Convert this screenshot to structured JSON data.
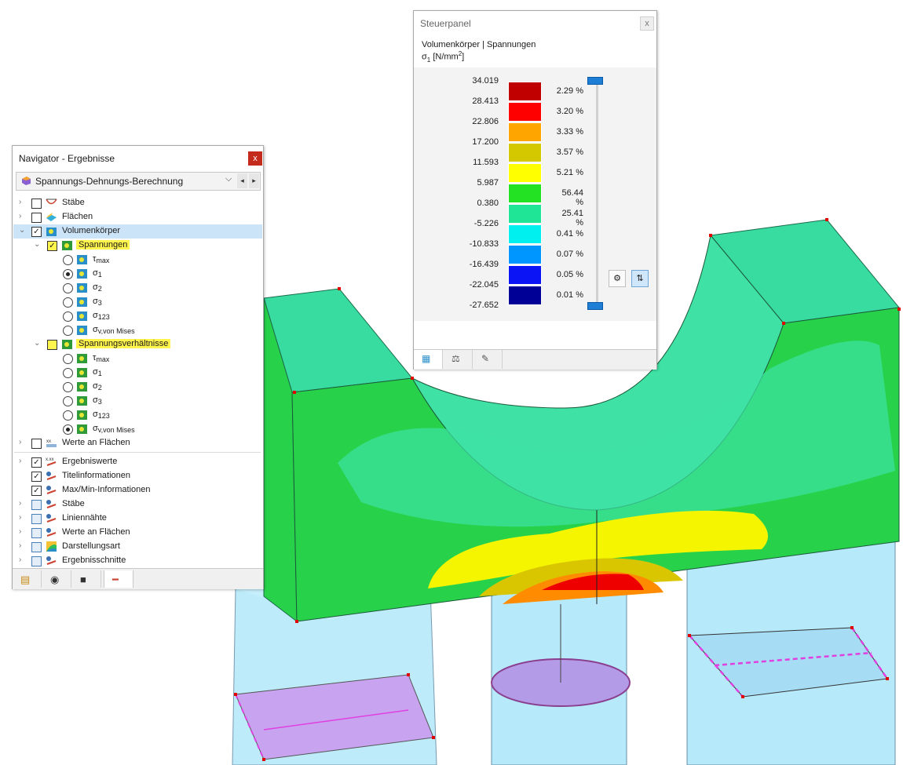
{
  "navigator": {
    "title": "Navigator - Ergebnisse",
    "close": "x",
    "combo": {
      "label": "Spannungs-Dehnungs-Berechnung",
      "arrow": "⌵",
      "prev": "◂",
      "next": "▸"
    },
    "items": [
      {
        "label": "Stäbe"
      },
      {
        "label": "Flächen"
      },
      {
        "label": "Volumenkörper"
      },
      {
        "label": "Spannungen"
      },
      {
        "label": "τ",
        "sub": "max"
      },
      {
        "label": "σ",
        "sub": "1"
      },
      {
        "label": "σ",
        "sub": "2"
      },
      {
        "label": "σ",
        "sub": "3"
      },
      {
        "label": "σ",
        "sub": "123"
      },
      {
        "label": "σ",
        "sub": "v,von Mises"
      },
      {
        "label": "Spannungsverhältnisse"
      },
      {
        "label": "τ",
        "sub": "max"
      },
      {
        "label": "σ",
        "sub": "1"
      },
      {
        "label": "σ",
        "sub": "2"
      },
      {
        "label": "σ",
        "sub": "3"
      },
      {
        "label": "σ",
        "sub": "123"
      },
      {
        "label": "σ",
        "sub": "v,von Mises"
      },
      {
        "label": "Werte an Flächen"
      },
      {
        "label": "Ergebniswerte"
      },
      {
        "label": "Titelinformationen"
      },
      {
        "label": "Max/Min-Informationen"
      },
      {
        "label": "Stäbe"
      },
      {
        "label": "Liniennähte"
      },
      {
        "label": "Werte an Flächen"
      },
      {
        "label": "Darstellungsart"
      },
      {
        "label": "Ergebnisschnitte"
      }
    ],
    "tabs": [
      "data-icon",
      "eye-icon",
      "camera-icon",
      "display-icon"
    ]
  },
  "control_panel": {
    "title": "Steuerpanel",
    "close": "x",
    "header": "Volumenkörper | Spannungen",
    "quantity": "σ",
    "quantity_sub": "1",
    "unit": "[N/mm",
    "unit_sup": "2",
    "unit_end": "]",
    "scale_values": [
      "34.019",
      "28.413",
      "22.806",
      "17.200",
      "11.593",
      "5.987",
      "0.380",
      "-5.226",
      "-10.833",
      "-16.439",
      "-22.045",
      "-27.652"
    ],
    "bands": [
      {
        "color": "#c00000",
        "percent": "2.29 %"
      },
      {
        "color": "#ff0000",
        "percent": "3.20 %"
      },
      {
        "color": "#ffa500",
        "percent": "3.33 %"
      },
      {
        "color": "#d4c800",
        "percent": "3.57 %"
      },
      {
        "color": "#ffff00",
        "percent": "5.21 %"
      },
      {
        "color": "#23e123",
        "percent": "56.44 %"
      },
      {
        "color": "#1ee696",
        "percent": "25.41 %"
      },
      {
        "color": "#00f0f0",
        "percent": "0.41 %"
      },
      {
        "color": "#0096ff",
        "percent": "0.07 %"
      },
      {
        "color": "#0a14f5",
        "percent": "0.05 %"
      },
      {
        "color": "#000096",
        "percent": "0.01 %"
      }
    ],
    "tabs": [
      "color-scale-icon",
      "balance-icon",
      "settings-icon"
    ]
  },
  "colors": {
    "top_face": "#4fe07a",
    "iso_blue": "#aee8f7",
    "support_blue": "#9fdef2",
    "purple": "#c49cf0",
    "line_magenta": "#e040e0",
    "node_red": "#e00000",
    "arrow_blue": "#0b3fd6"
  }
}
